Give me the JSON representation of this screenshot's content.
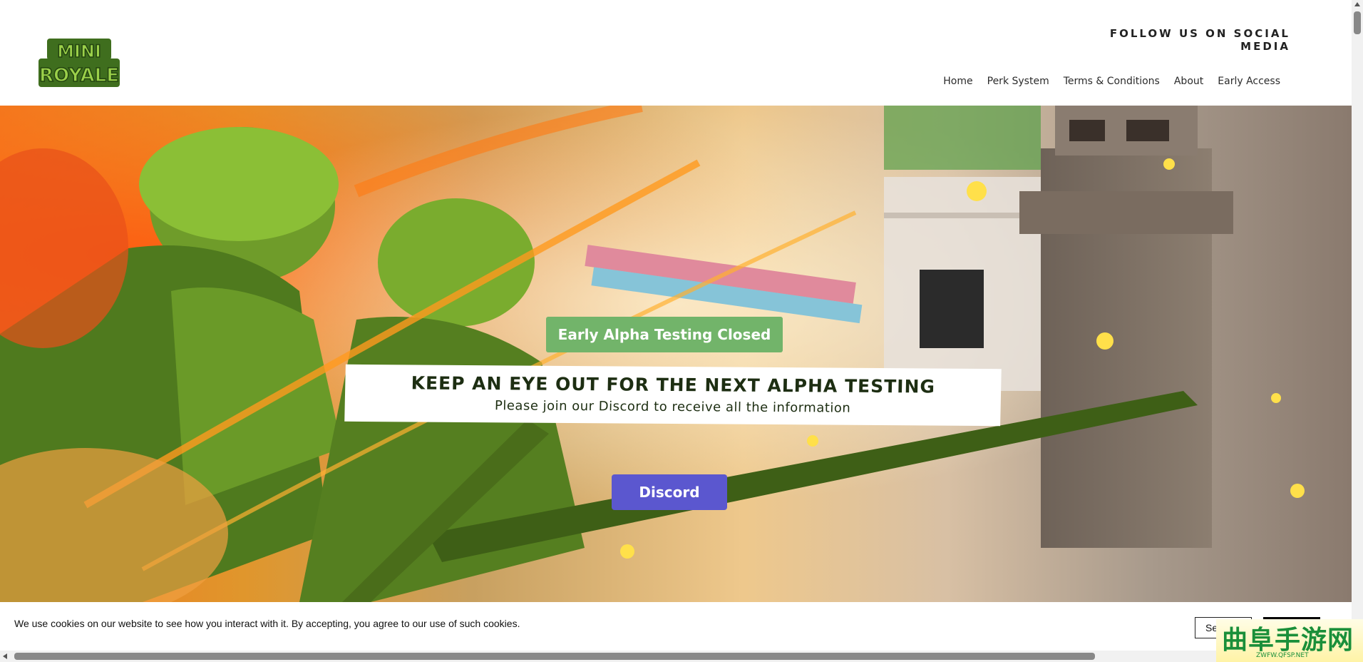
{
  "header": {
    "logo_text_top": "MINI",
    "logo_text_bottom": "ROYALE",
    "follow_label": "FOLLOW US ON SOCIAL MEDIA",
    "nav": [
      "Home",
      "Perk System",
      "Terms & Conditions",
      "About",
      "Early Access"
    ]
  },
  "hero": {
    "status_label": "Early Alpha Testing Closed",
    "headline": "KEEP AN EYE OUT FOR THE NEXT ALPHA TESTING",
    "subline": "Please join our Discord to receive all the information",
    "discord_label": "Discord"
  },
  "cookie": {
    "text": "We use cookies on our website to see how you interact with it. By accepting, you agree to our use of such cookies.",
    "settings_label": "Se",
    "accept_label": ""
  },
  "watermark": {
    "chinese": "曲阜手游网",
    "url": "ZWFW.QFSP.NET"
  },
  "colors": {
    "status_green": "#72b46a",
    "discord_purple": "#5b57cf",
    "headline_dark": "#1d2e12"
  }
}
